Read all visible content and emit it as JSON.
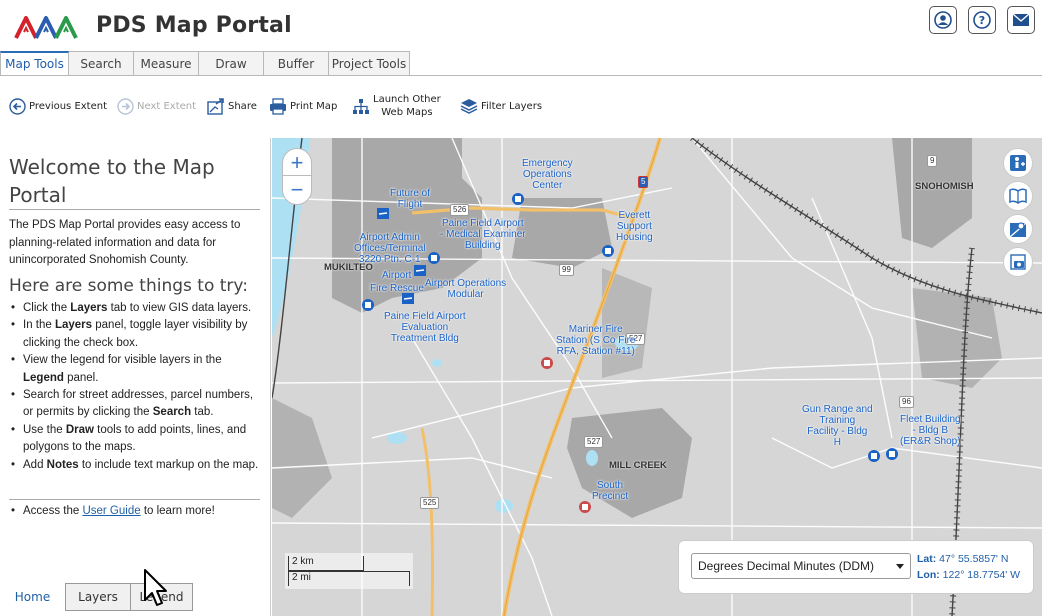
{
  "header": {
    "title": "PDS Map Portal",
    "logo_icon": "pds-logo-icon",
    "buttons": [
      {
        "name": "user-account-icon"
      },
      {
        "name": "help-icon"
      },
      {
        "name": "mail-icon"
      }
    ]
  },
  "tabs": [
    {
      "label": "Map Tools",
      "active": true
    },
    {
      "label": "Search"
    },
    {
      "label": "Measure"
    },
    {
      "label": "Draw"
    },
    {
      "label": "Buffer"
    },
    {
      "label": "Project Tools"
    }
  ],
  "toolbar": {
    "previous_extent": "Previous Extent",
    "next_extent": "Next Extent",
    "share": "Share",
    "print_map": "Print Map",
    "launch_line1": "Launch Other",
    "launch_line2": "Web Maps",
    "filter_layers": "Filter Layers"
  },
  "panel": {
    "welcome_line1": "Welcome to the Map",
    "welcome_line2": "Portal",
    "intro": "The PDS Map Portal provides easy access to planning-related information and data for unincorporated Snohomish County.",
    "try_title": "Here are some things to try:",
    "tips": [
      [
        "Click the ",
        "Layers",
        " tab to view GIS data layers."
      ],
      [
        "In the ",
        "Layers",
        " panel, toggle layer visibility by clicking the check box."
      ],
      [
        "View the legend for visible layers in the ",
        "Legend",
        " panel."
      ],
      [
        "Search for street addresses, parcel numbers, or permits by clicking the ",
        "Search",
        " tab."
      ],
      [
        "Use the ",
        "Draw",
        " tools to add points, lines, and polygons to the maps."
      ],
      [
        "Add ",
        "Notes",
        " to include text markup on the map."
      ]
    ],
    "guide_prefix": "Access the ",
    "guide_link": "User Guide",
    "guide_suffix": " to learn more!"
  },
  "bottom_tabs": [
    {
      "label": "Home",
      "active": true
    },
    {
      "label": "Layers"
    },
    {
      "label": "Legend"
    }
  ],
  "map": {
    "zoom_in": "+",
    "zoom_out": "−",
    "places": {
      "mukilteo": "MUKILTEO",
      "snohomish": "SNOHOMISH",
      "mill_creek": "MILL CREEK"
    },
    "poi": {
      "emergency": "Emergency\nOperations\nCenter",
      "future_flight": "Future of\nFlight",
      "paine_examiner": "Paine Field Airport\n- Medical Examiner\nBuilding",
      "everett_support": "Everett\nSupport\nHousing",
      "airport_admin": "Airport Admin\nOffices/Terminal\n3220 Ptn. C-1",
      "airport": "Airport",
      "fire_rescue": "Fire Rescue",
      "airport_ops": "Airport Operations\nModular",
      "paine_eval": "Paine Field Airport\nEvaluation\nTreatment Bldg",
      "mariner_fire": "Mariner Fire\nStation (S Co Fire\nRFA, Station #11)",
      "gun_range": "Gun Range and\nTraining\nFacility - Bldg\nH",
      "fleet_building": "Fleet Building\n- Bldg B\n(ER&R Shop)",
      "south_precinct": "South\nPrecinct"
    },
    "shields": {
      "r526": "526",
      "r5": "5",
      "r99": "99",
      "r527a": "527",
      "r527b": "527",
      "r525": "525",
      "r9": "9",
      "r96": "96"
    },
    "scale_km": "2 km",
    "scale_mi": "2 mi",
    "coord_format": "Degrees Decimal Minutes (DDM)",
    "lat_label": "Lat:",
    "lat_value": "47° 55.5857' N",
    "lon_label": "Lon:",
    "lon_value": "122° 18.7754' W"
  }
}
